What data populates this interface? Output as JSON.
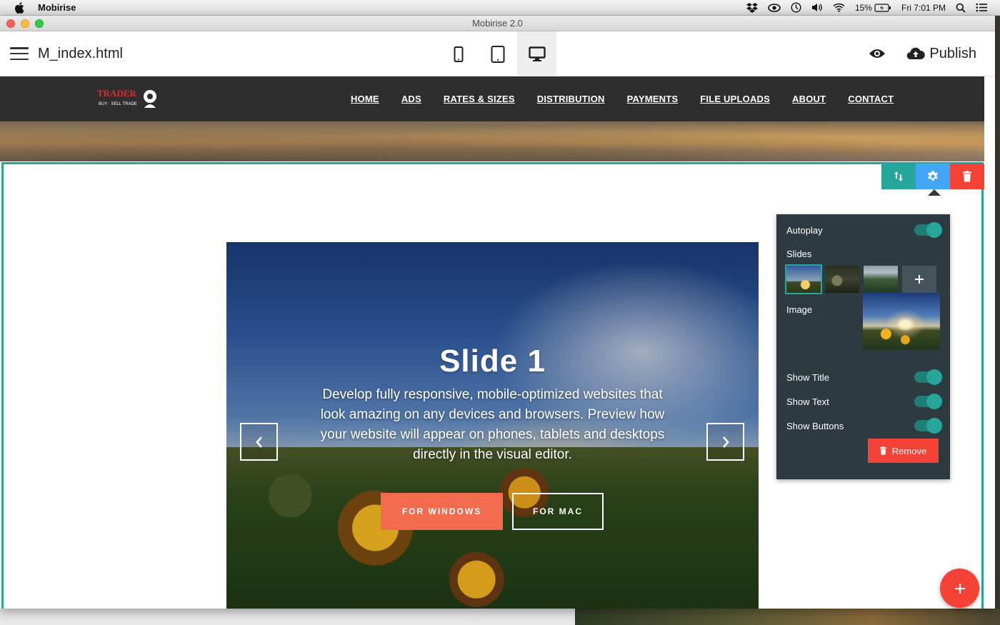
{
  "menubar": {
    "app_name": "Mobirise",
    "battery": "15%",
    "clock": "Fri 7:01 PM"
  },
  "window": {
    "title": "Mobirise 2.0"
  },
  "toolbar": {
    "filename": "M_index.html",
    "publish_label": "Publish",
    "devices": [
      "phone",
      "tablet",
      "desktop"
    ],
    "active_device": "desktop"
  },
  "site_nav": {
    "logo_text": "TRADER",
    "logo_sub": "BUY · SELL TRADE",
    "links": [
      "HOME",
      "ADS",
      "RATES & SIZES",
      "DISTRIBUTION",
      "PAYMENTS",
      "FILE UPLOADS",
      "ABOUT",
      "CONTACT"
    ]
  },
  "slider": {
    "title": "Slide 1",
    "text": "Develop fully responsive, mobile-optimized websites that look amazing on any devices and browsers. Preview how your website will appear on phones, tablets and desktops directly in the visual editor.",
    "button_primary": "FOR WINDOWS",
    "button_secondary": "FOR MAC",
    "slide_count": 3,
    "active_slide": 1
  },
  "panel": {
    "autoplay_label": "Autoplay",
    "slides_label": "Slides",
    "image_label": "Image",
    "show_title_label": "Show Title",
    "show_text_label": "Show Text",
    "show_buttons_label": "Show Buttons",
    "remove_label": "Remove",
    "autoplay": true,
    "show_title": true,
    "show_text": true,
    "show_buttons": true
  },
  "colors": {
    "accent": "#26a69a",
    "gear": "#42a5f5",
    "danger": "#f44336",
    "cta": "#f26b4f",
    "panel_bg": "#2d3a3f",
    "nav_bg": "#2e2e2e"
  }
}
